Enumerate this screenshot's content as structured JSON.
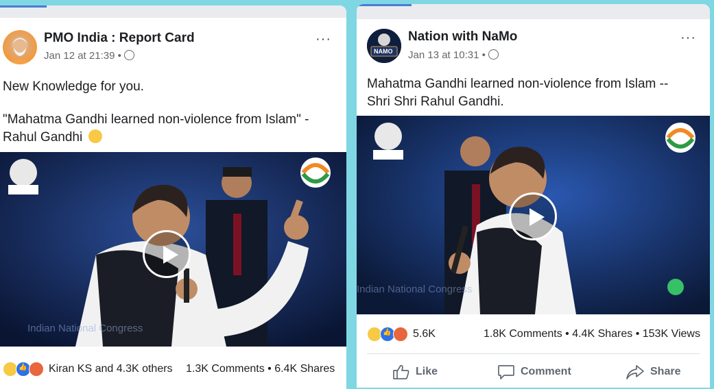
{
  "left_post": {
    "page_name": "PMO India : Report Card",
    "timestamp": "Jan 12 at 21:39",
    "text_line1": "New Knowledge for you.",
    "text_line2": "\"Mahatma Gandhi learned non-violence from Islam\" -",
    "text_line3": "Rahul Gandhi",
    "reaction_summary": "Kiran KS and 4.3K others",
    "comments_shares": "1.3K Comments • 6.4K Shares",
    "video_caption": "Indian National Congress"
  },
  "right_post": {
    "page_name": "Nation with NaMo",
    "avatar_label": "NAMO",
    "timestamp": "Jan 13 at 10:31",
    "text_line1": "Mahatma Gandhi learned non-violence from Islam --",
    "text_line2": "Shri Shri Rahul Gandhi.",
    "reaction_count": "5.6K",
    "stats": "1.8K Comments • 4.4K Shares • 153K Views",
    "like_label": "Like",
    "comment_label": "Comment",
    "share_label": "Share",
    "video_caption": "Indian National Congress"
  },
  "separator": " • ",
  "more_glyph": "···",
  "globe_icon": "globe-icon",
  "accent_color": "#4a7bd0"
}
